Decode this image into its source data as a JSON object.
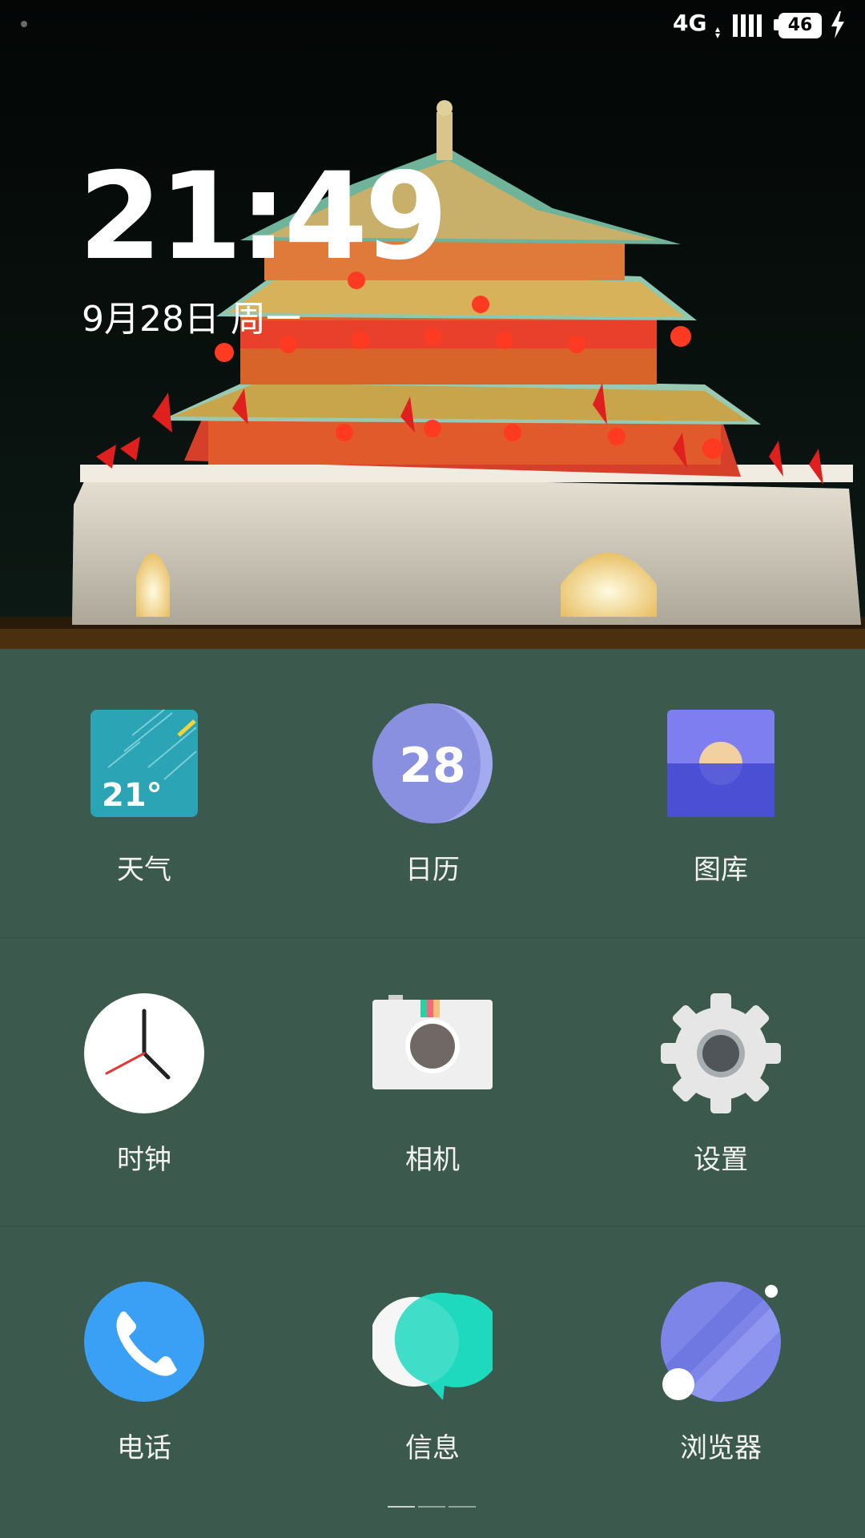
{
  "status_bar": {
    "network": "4G",
    "battery_level": "46"
  },
  "clock_widget": {
    "time": "21:49",
    "date": "9月28日  周一"
  },
  "apps": [
    {
      "label": "天气",
      "icon": "weather-icon",
      "badge": "21°"
    },
    {
      "label": "日历",
      "icon": "calendar-icon",
      "badge": "28"
    },
    {
      "label": "图库",
      "icon": "gallery-icon"
    },
    {
      "label": "时钟",
      "icon": "clock-icon"
    },
    {
      "label": "相机",
      "icon": "camera-icon"
    },
    {
      "label": "设置",
      "icon": "settings-gear-icon"
    },
    {
      "label": "电话",
      "icon": "phone-icon"
    },
    {
      "label": "信息",
      "icon": "messages-icon"
    },
    {
      "label": "浏览器",
      "icon": "browser-icon"
    }
  ],
  "colors": {
    "grid_background": "#3b594c",
    "weather": "#2ba5b6",
    "calendar": "#8a90e0",
    "gallery_top": "#7e7ef0",
    "gallery_bottom": "#4b4fd4",
    "phone": "#3aa0f5",
    "messages": "#1fd9bf"
  }
}
